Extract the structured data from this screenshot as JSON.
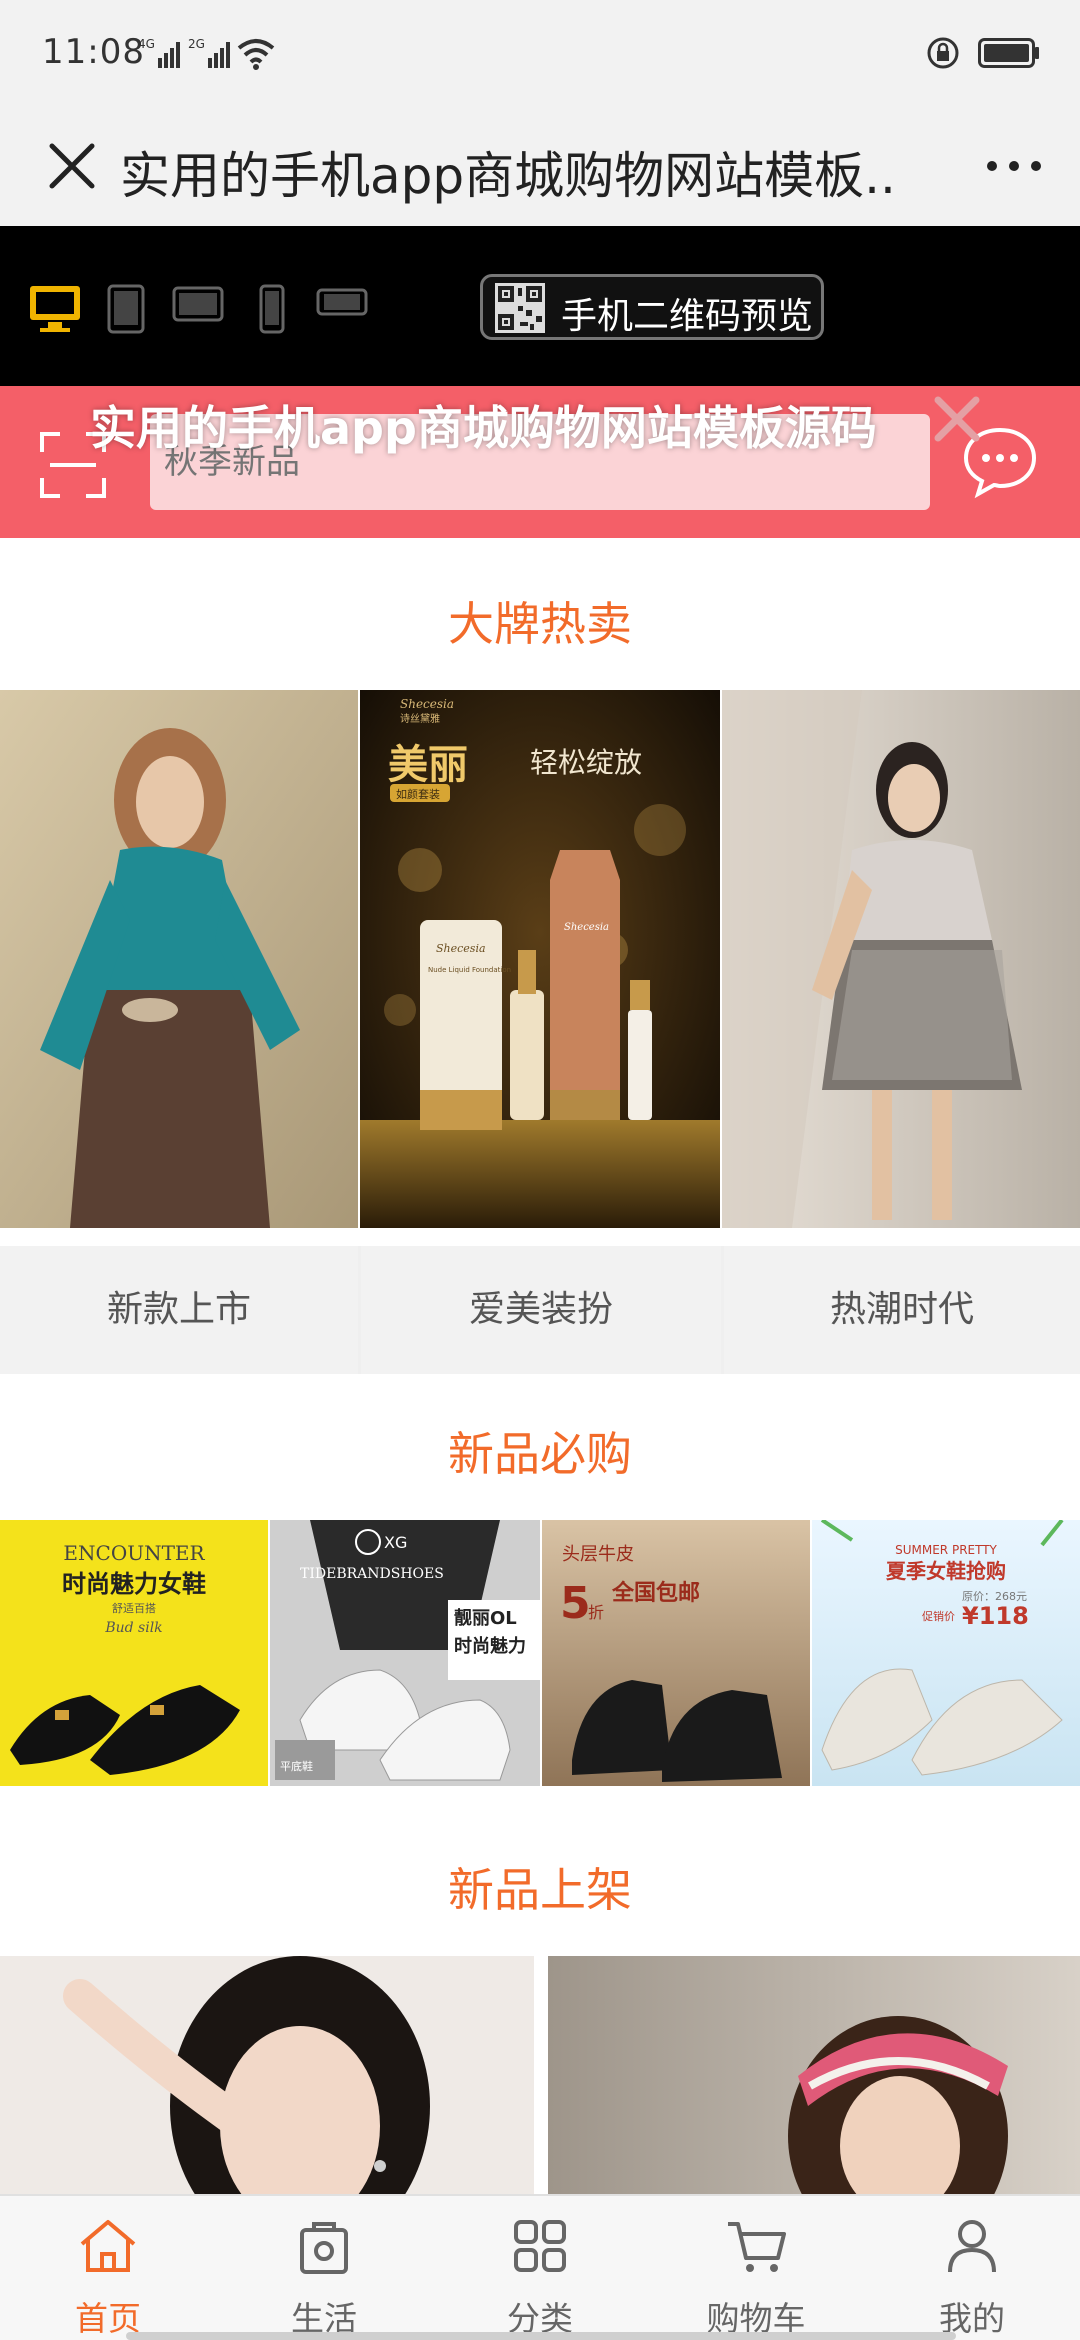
{
  "status": {
    "time": "11:08",
    "net1": "4G",
    "net2": "2G"
  },
  "titlebar": {
    "title": "实用的手机app商城购物网站模板...",
    "close_icon": "close-icon",
    "more_icon": "more-icon"
  },
  "devicebar": {
    "icons": [
      "desktop-icon",
      "tablet-icon",
      "tablet-landscape-icon",
      "phone-icon",
      "phone-landscape-icon"
    ],
    "qr_label": "手机二维码预览"
  },
  "search": {
    "placeholder": "秋季新品",
    "overlay_title": "实用的手机app商城购物网站模板源码"
  },
  "sections": {
    "brand_hot": "大牌热卖",
    "must_buy": "新品必购",
    "new_arrivals": "新品上架"
  },
  "brand_images": [
    {
      "alt": "teal-sweater-model"
    },
    {
      "alt": "cosmetics-ad",
      "brand": "Shecesia",
      "brand_cn": "诗丝黛雅",
      "headline": "美丽",
      "tagline": "轻松绽放",
      "badge": "如颜套装",
      "bottle1": "Shecesia",
      "bottle1_sub": "Nude Liquid Foundation",
      "bottle2": "Shecesia"
    },
    {
      "alt": "floral-dress-model"
    }
  ],
  "categories": [
    "新款上市",
    "爱美装扮",
    "热潮时代"
  ],
  "must_buy_images": [
    {
      "alt": "black-heels",
      "en": "ENCOUNTER",
      "cn": "时尚魅力女鞋",
      "sub": "舒适百搭",
      "script": "Bud silk"
    },
    {
      "alt": "white-sneakers",
      "logo": "XG",
      "en": "TIDEBRANDSHOES",
      "cn1": "靓丽OL",
      "cn2": "时尚魅力",
      "foot": "平底鞋"
    },
    {
      "alt": "black-boots",
      "cn1": "头层牛皮",
      "cn2": "全国包邮",
      "discount": "5",
      "discount_unit": "折"
    },
    {
      "alt": "nude-pumps",
      "en": "SUMMER PRETTY",
      "cn": "夏季女鞋抢购",
      "price_orig": "原价：268元",
      "price_label": "促销价",
      "price": "¥118"
    }
  ],
  "bottom_nav": [
    {
      "label": "首页",
      "icon": "home-icon",
      "active": true
    },
    {
      "label": "生活",
      "icon": "life-bag-icon",
      "active": false
    },
    {
      "label": "分类",
      "icon": "category-grid-icon",
      "active": false
    },
    {
      "label": "购物车",
      "icon": "cart-icon",
      "active": false
    },
    {
      "label": "我的",
      "icon": "user-icon",
      "active": false
    }
  ],
  "colors": {
    "accent": "#f26b2a",
    "search_bg": "#f45f68",
    "device_bar": "#000000"
  }
}
